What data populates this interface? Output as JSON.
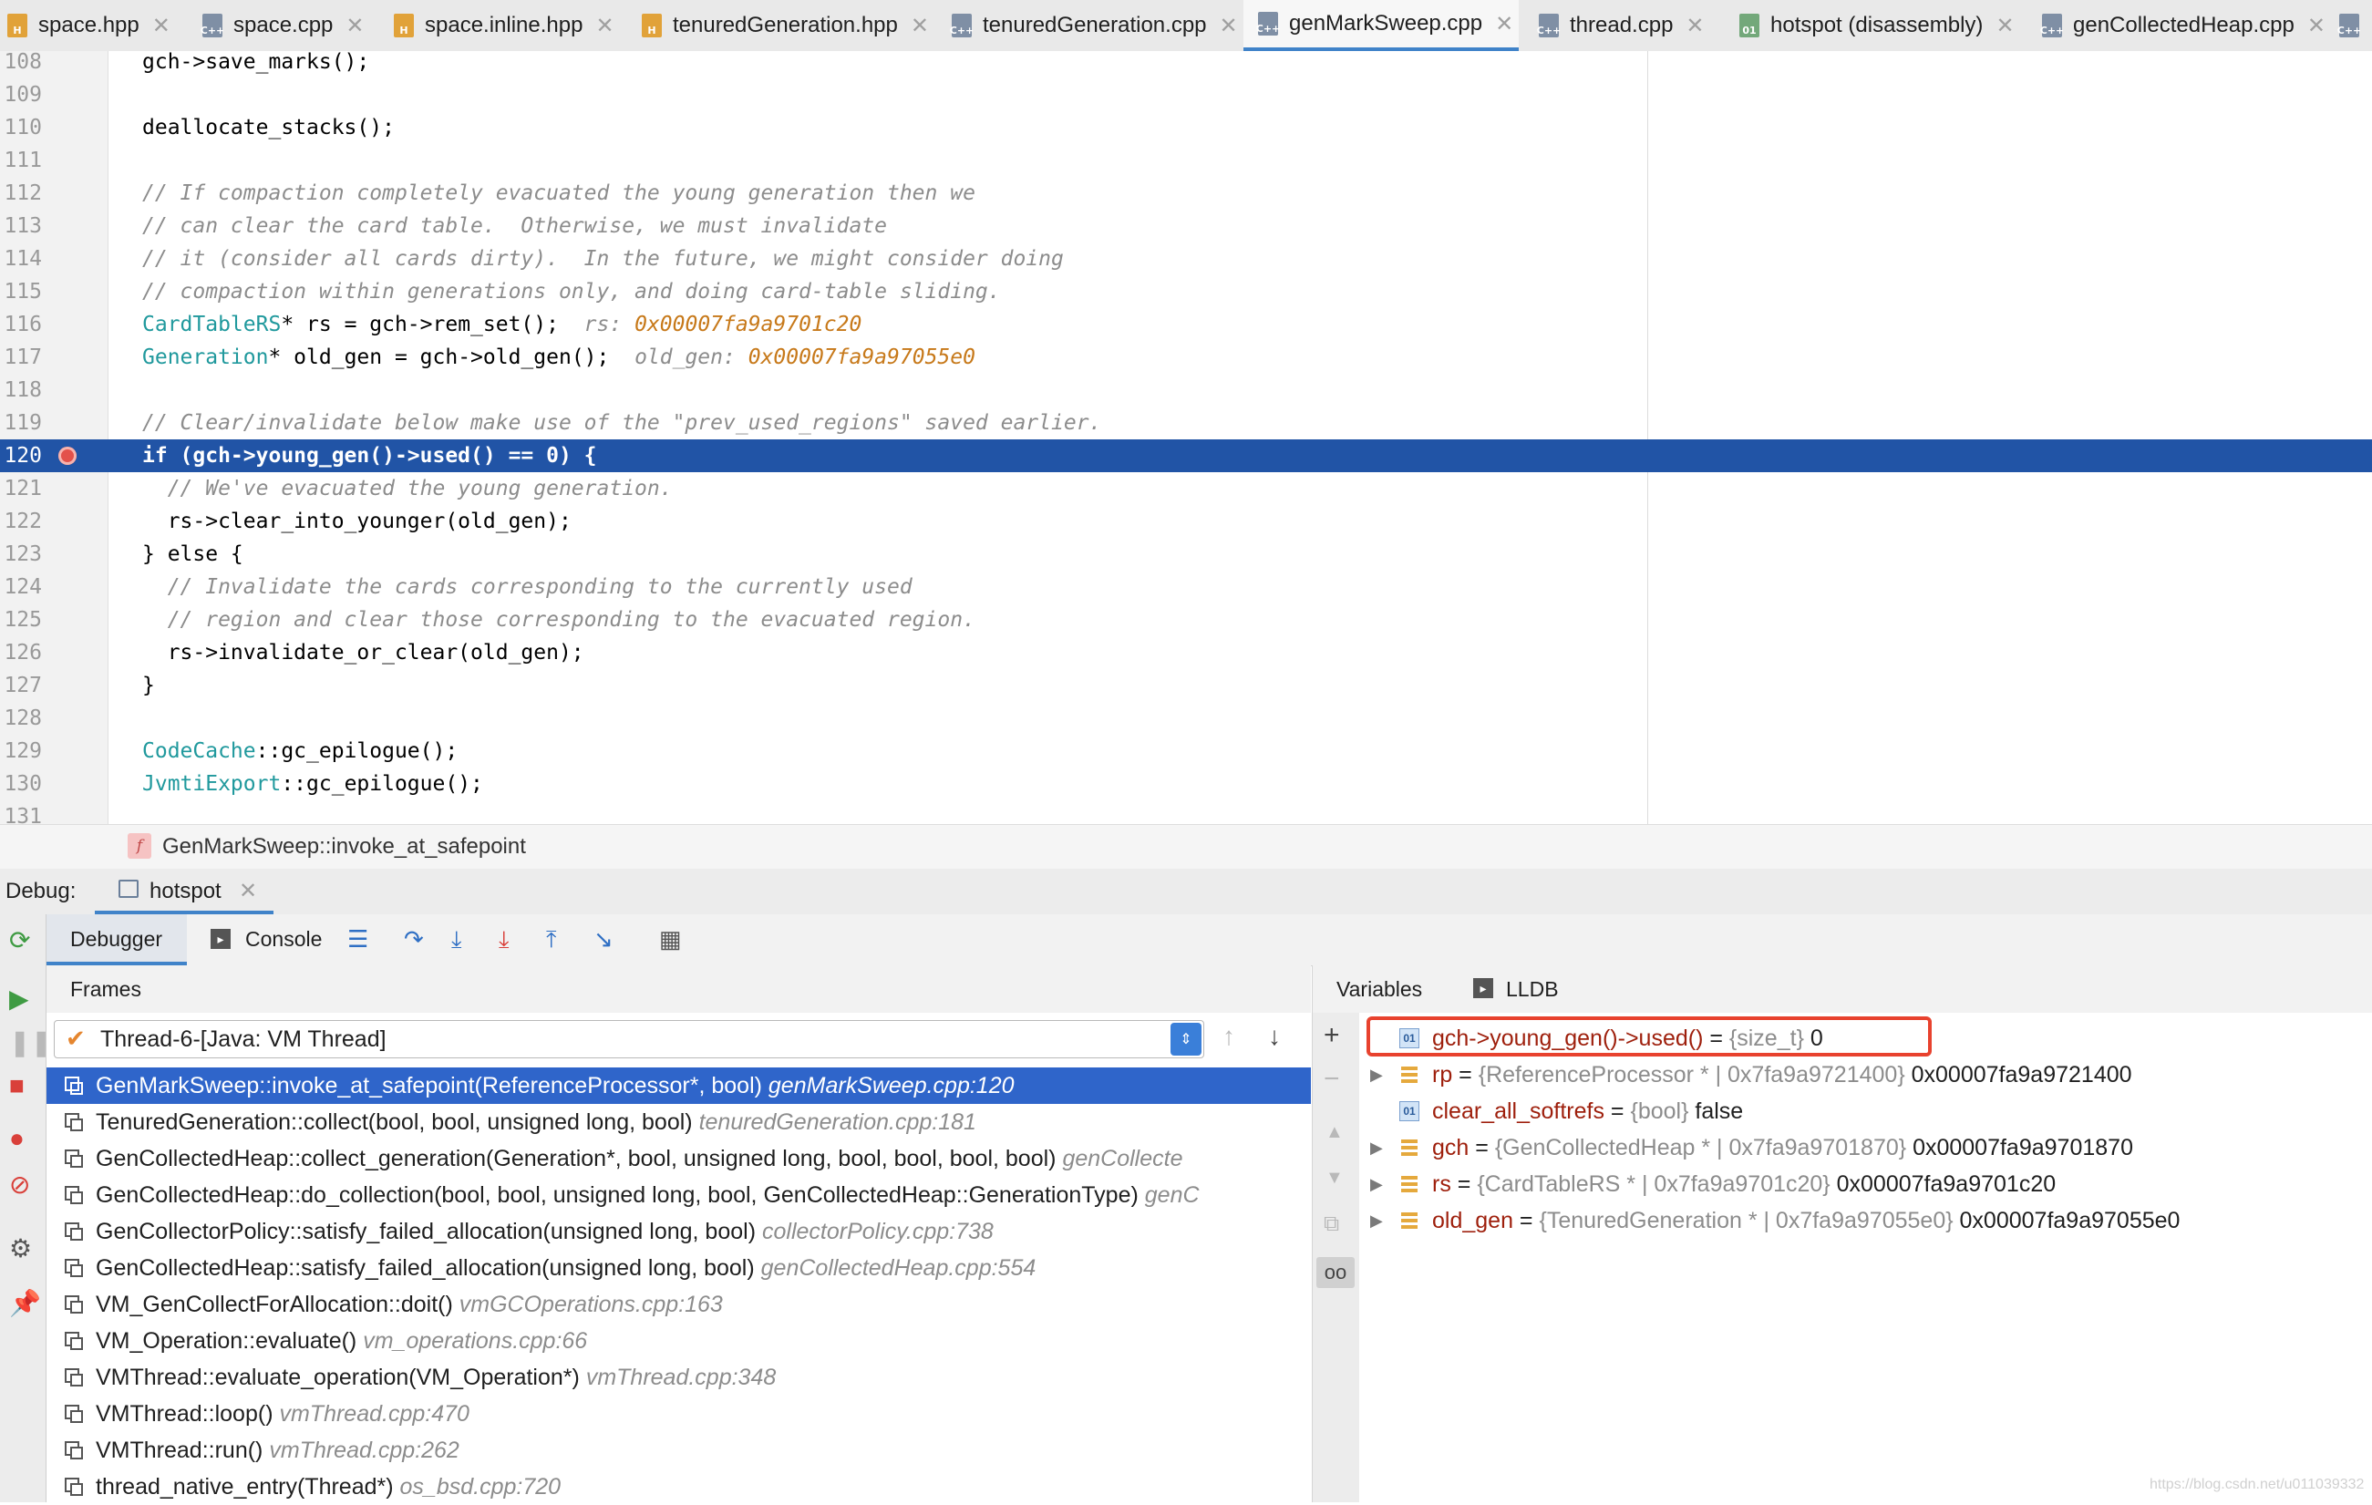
{
  "tabs": [
    {
      "label": "space.hpp",
      "type": "H",
      "active": false
    },
    {
      "label": "space.cpp",
      "type": "C++",
      "active": false
    },
    {
      "label": "space.inline.hpp",
      "type": "H",
      "active": false
    },
    {
      "label": "tenuredGeneration.hpp",
      "type": "H",
      "active": false
    },
    {
      "label": "tenuredGeneration.cpp",
      "type": "C++",
      "active": false
    },
    {
      "label": "genMarkSweep.cpp",
      "type": "C++",
      "active": true
    },
    {
      "label": "thread.cpp",
      "type": "C++",
      "active": false
    },
    {
      "label": "hotspot (disassembly)",
      "type": "01",
      "active": false
    },
    {
      "label": "genCollectedHeap.cpp",
      "type": "C++",
      "active": false
    }
  ],
  "editor": {
    "highlight_line": 120,
    "lines": [
      {
        "n": "108",
        "code": "gch->save_marks();"
      },
      {
        "n": "109",
        "code": ""
      },
      {
        "n": "110",
        "code": "deallocate_stacks();"
      },
      {
        "n": "111",
        "code": ""
      },
      {
        "n": "112",
        "code": "// If compaction completely evacuated the young generation then we"
      },
      {
        "n": "113",
        "code": "// can clear the card table.  Otherwise, we must invalidate"
      },
      {
        "n": "114",
        "code": "// it (consider all cards dirty).  In the future, we might consider doing"
      },
      {
        "n": "115",
        "code": "// compaction within generations only, and doing card-table sliding."
      },
      {
        "n": "116",
        "type": "CardTableRS",
        "code": "* rs = gch->rem_set();",
        "inline_label": "rs:",
        "inline_value": "0x00007fa9a9701c20"
      },
      {
        "n": "117",
        "type": "Generation",
        "code": "* old_gen = gch->old_gen();",
        "inline_label": "old_gen:",
        "inline_value": "0x00007fa9a97055e0"
      },
      {
        "n": "118",
        "code": ""
      },
      {
        "n": "119",
        "code": "// Clear/invalidate below make use of the \"prev_used_regions\" saved earlier."
      },
      {
        "n": "120",
        "code": "if (gch->young_gen()->used() == 0) {"
      },
      {
        "n": "121",
        "code": "  // We've evacuated the young generation."
      },
      {
        "n": "122",
        "code": "  rs->clear_into_younger(old_gen);"
      },
      {
        "n": "123",
        "code": "} else {"
      },
      {
        "n": "124",
        "code": "  // Invalidate the cards corresponding to the currently used"
      },
      {
        "n": "125",
        "code": "  // region and clear those corresponding to the evacuated region."
      },
      {
        "n": "126",
        "code": "  rs->invalidate_or_clear(old_gen);"
      },
      {
        "n": "127",
        "code": "}"
      },
      {
        "n": "128",
        "code": ""
      },
      {
        "n": "129",
        "type": "CodeCache",
        "code": "::gc_epilogue();"
      },
      {
        "n": "130",
        "type": "JvmtiExport",
        "code": "::gc_epilogue();"
      },
      {
        "n": "131",
        "code": ""
      }
    ]
  },
  "breadcrumb": {
    "icon": "f",
    "label": "GenMarkSweep::invoke_at_safepoint"
  },
  "debug": {
    "label": "Debug:",
    "session": "hotspot",
    "tabs": {
      "debugger": "Debugger",
      "console": "Console"
    },
    "frames_title": "Frames",
    "thread": "Thread-6-[Java: VM Thread]",
    "frames": [
      {
        "fn": "GenMarkSweep::invoke_at_safepoint(ReferenceProcessor*, bool)",
        "loc": "genMarkSweep.cpp:120"
      },
      {
        "fn": "TenuredGeneration::collect(bool, bool, unsigned long, bool)",
        "loc": "tenuredGeneration.cpp:181"
      },
      {
        "fn": "GenCollectedHeap::collect_generation(Generation*, bool, unsigned long, bool, bool, bool, bool)",
        "loc": "genCollecte"
      },
      {
        "fn": "GenCollectedHeap::do_collection(bool, bool, unsigned long, bool, GenCollectedHeap::GenerationType)",
        "loc": "genC"
      },
      {
        "fn": "GenCollectorPolicy::satisfy_failed_allocation(unsigned long, bool)",
        "loc": "collectorPolicy.cpp:738"
      },
      {
        "fn": "GenCollectedHeap::satisfy_failed_allocation(unsigned long, bool)",
        "loc": "genCollectedHeap.cpp:554"
      },
      {
        "fn": "VM_GenCollectForAllocation::doit()",
        "loc": "vmGCOperations.cpp:163"
      },
      {
        "fn": "VM_Operation::evaluate()",
        "loc": "vm_operations.cpp:66"
      },
      {
        "fn": "VMThread::evaluate_operation(VM_Operation*)",
        "loc": "vmThread.cpp:348"
      },
      {
        "fn": "VMThread::loop()",
        "loc": "vmThread.cpp:470"
      },
      {
        "fn": "VMThread::run()",
        "loc": "vmThread.cpp:262"
      },
      {
        "fn": "thread_native_entry(Thread*)",
        "loc": "os_bsd.cpp:720"
      }
    ],
    "vars_tabs": {
      "variables": "Variables",
      "lldb": "LLDB"
    },
    "variables": [
      {
        "name": "gch->young_gen()->used()",
        "type": "{size_t}",
        "value": "0",
        "kind": "prim",
        "expandable": false,
        "highlighted": true
      },
      {
        "name": "rp",
        "type": "{ReferenceProcessor * | 0x7fa9a9721400}",
        "value": "0x00007fa9a9721400",
        "kind": "obj",
        "expandable": true
      },
      {
        "name": "clear_all_softrefs",
        "type": "{bool}",
        "value": "false",
        "kind": "prim",
        "expandable": false
      },
      {
        "name": "gch",
        "type": "{GenCollectedHeap * | 0x7fa9a9701870}",
        "value": "0x00007fa9a9701870",
        "kind": "obj",
        "expandable": true
      },
      {
        "name": "rs",
        "type": "{CardTableRS * | 0x7fa9a9701c20}",
        "value": "0x00007fa9a9701c20",
        "kind": "obj",
        "expandable": true
      },
      {
        "name": "old_gen",
        "type": "{TenuredGeneration * | 0x7fa9a97055e0}",
        "value": "0x00007fa9a97055e0",
        "kind": "obj",
        "expandable": true
      }
    ],
    "highlight_color": "#e8422e",
    "selection_color": "#2f65ca"
  },
  "watermark": "https://blog.csdn.net/u011039332"
}
